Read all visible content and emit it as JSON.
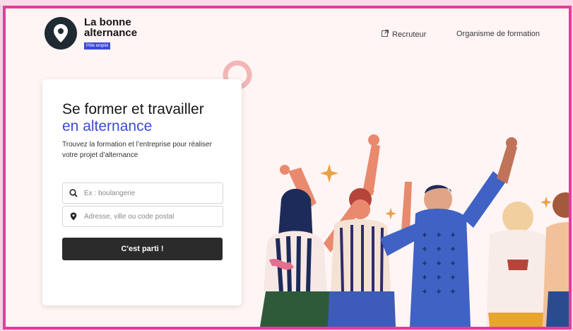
{
  "header": {
    "logo_line1": "La bonne",
    "logo_line2": "alternance",
    "logo_badge": "Pôle emploi",
    "nav": [
      {
        "label": "Recruteur",
        "icon": "external-link-icon"
      },
      {
        "label": "Organisme de formation"
      }
    ]
  },
  "hero": {
    "title_line1": "Se former et travailler",
    "title_line2": "en alternance",
    "subtitle": "Trouvez la formation et l’entreprise pour réaliser votre projet d’alternance"
  },
  "search": {
    "job_placeholder": "Ex : boulangerie",
    "job_icon": "search-icon",
    "location_placeholder": "Adresse, ville ou code postal",
    "location_icon": "location-pin-icon",
    "submit_label": "C'est parti !"
  },
  "colors": {
    "accent_blue": "#3d4ad6",
    "frame_pink": "#e23d9c",
    "button_dark": "#2b2b2b",
    "background": "#fff5f4"
  }
}
